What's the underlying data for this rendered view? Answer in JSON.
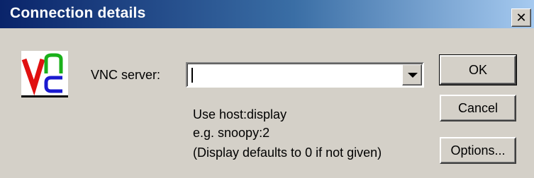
{
  "window": {
    "title": "Connection details",
    "close_glyph": "✕"
  },
  "logo": {
    "icon": "vnc-logo-icon",
    "colors": {
      "v": "#e01010",
      "n": "#1ab01a",
      "c": "#1a1ad0"
    }
  },
  "server": {
    "label": "VNC server:",
    "value": "",
    "placeholder": ""
  },
  "hint": {
    "line1": "Use host:display",
    "line2": "e.g. snoopy:2",
    "line3": "(Display defaults to 0 if not given)"
  },
  "buttons": {
    "ok": "OK",
    "cancel": "Cancel",
    "options": "Options..."
  },
  "colors": {
    "titlebar_start": "#0a246a",
    "titlebar_end": "#a6caf0",
    "face": "#d4d0c8"
  }
}
